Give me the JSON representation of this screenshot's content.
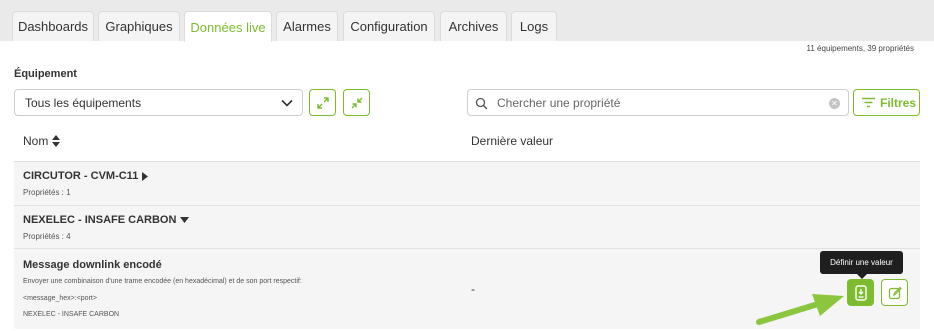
{
  "tabs": [
    {
      "label": "Dashboards",
      "active": false
    },
    {
      "label": "Graphiques",
      "active": false
    },
    {
      "label": "Données live",
      "active": true
    },
    {
      "label": "Alarmes",
      "active": false
    },
    {
      "label": "Configuration",
      "active": false
    },
    {
      "label": "Archives",
      "active": false
    },
    {
      "label": "Logs",
      "active": false
    }
  ],
  "summary": "11 équipements, 39 propriétés",
  "filter": {
    "equipment_label": "Équipement",
    "equipment_selected": "Tous les équipements",
    "search_placeholder": "Chercher une propriété",
    "filters_label": "Filtres"
  },
  "table": {
    "headers": {
      "name": "Nom",
      "last_value": "Dernière valeur"
    },
    "groups": [
      {
        "name": "CIRCUTOR - CVM-C11",
        "properties": "Propriétés : 1",
        "expanded": false
      },
      {
        "name": "NEXELEC - INSAFE CARBON",
        "properties": "Propriétés : 4",
        "expanded": true
      }
    ],
    "property": {
      "name": "Message downlink encodé",
      "description": "Envoyer une combinaison d'une trame encodée (en hexadécimal) et de son port respectif:",
      "format": "<message_hex>:<port>",
      "equipment": "NEXELEC - INSAFE CARBON",
      "value": "-"
    }
  },
  "tooltip": "Définir une valeur",
  "colors": {
    "accent": "#7dbb2f",
    "tab_bar": "#eaeaea",
    "row_bg": "#f5f5f5",
    "tooltip_bg": "#1f1f1f"
  },
  "icons": {
    "expand": "expand-icon",
    "collapse": "collapse-icon",
    "search": "search-icon",
    "clear": "clear-icon",
    "filter": "filter-icon",
    "sort": "sort-icon",
    "set_value": "set-value-icon",
    "edit": "edit-icon",
    "annotation": "annotation-arrow"
  }
}
